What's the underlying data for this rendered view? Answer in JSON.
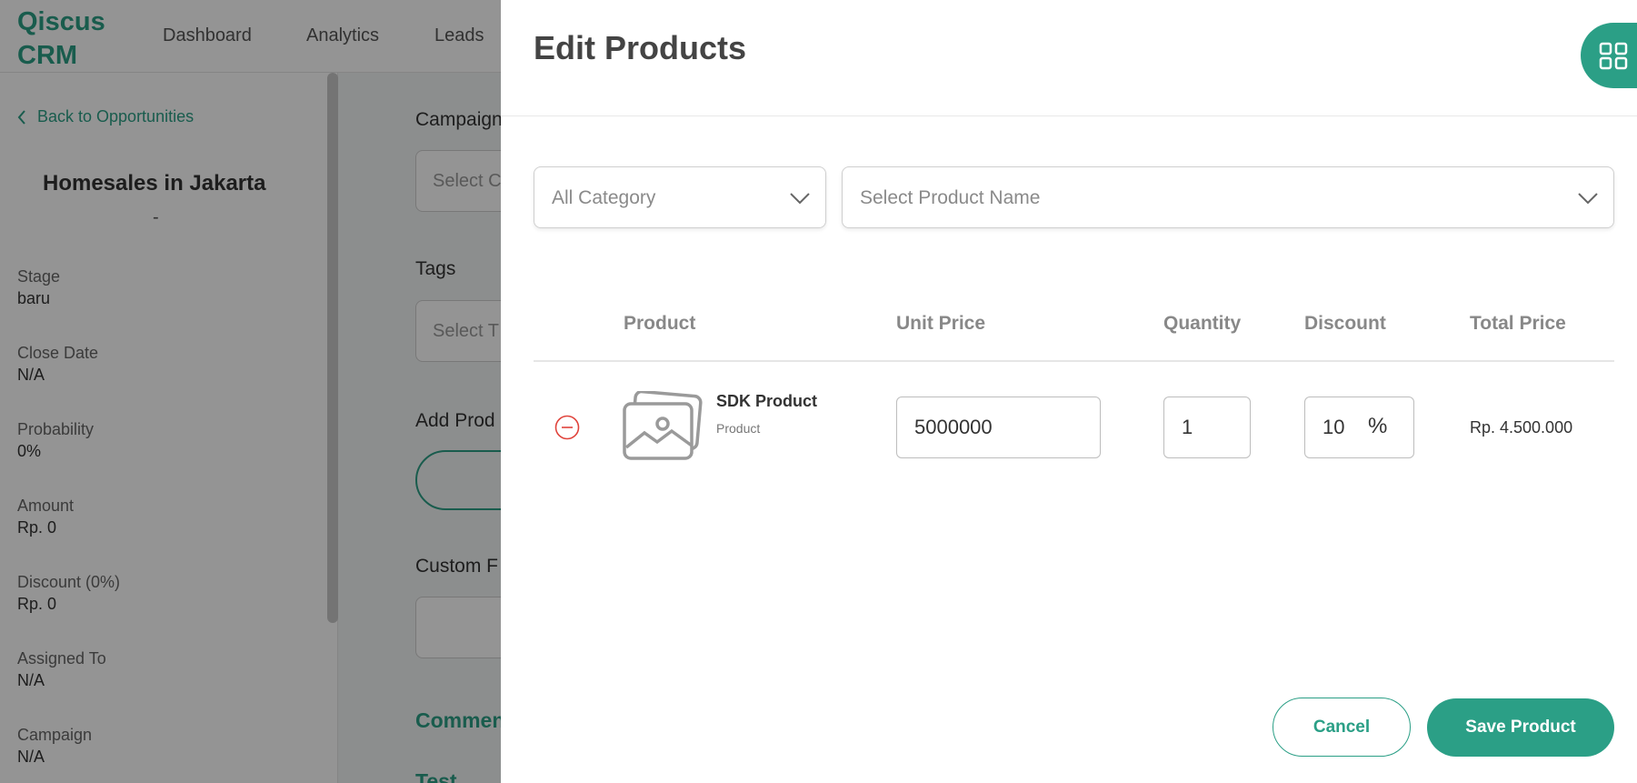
{
  "app": {
    "logo": "Qiscus\nCRM",
    "nav": [
      "Dashboard",
      "Analytics",
      "Leads"
    ]
  },
  "sidebar": {
    "back_label": "Back to Opportunities",
    "title": "Homesales in Jakarta",
    "subtitle": "-",
    "fields": [
      {
        "label": "Stage",
        "value": "baru"
      },
      {
        "label": "Close Date",
        "value": "N/A"
      },
      {
        "label": "Probability",
        "value": "0%"
      },
      {
        "label": "Amount",
        "value": "Rp. 0"
      },
      {
        "label": "Discount (0%)",
        "value": "Rp. 0"
      },
      {
        "label": "Assigned To",
        "value": "N/A"
      },
      {
        "label": "Campaign",
        "value": "N/A"
      }
    ]
  },
  "main": {
    "campaign_label": "Campaign",
    "campaign_placeholder": "Select C",
    "tags_label": "Tags",
    "tags_placeholder": "Select T",
    "add_products_label": "Add Prod",
    "custom_fields_label": "Custom F",
    "comments_label": "Commen",
    "test_label": "Test"
  },
  "drawer": {
    "title": "Edit Products",
    "apps_icon": "grid-apps-icon",
    "category_placeholder": "All Category",
    "product_placeholder": "Select Product Name",
    "table": {
      "headers": [
        "Product",
        "Unit Price",
        "Quantity",
        "Discount",
        "Total Price"
      ],
      "rows": [
        {
          "name": "SDK Product",
          "category": "Product",
          "unit_price": "5000000",
          "quantity": "1",
          "discount": "10",
          "discount_unit": "%",
          "total": "Rp. 4.500.000"
        }
      ]
    },
    "cancel_label": "Cancel",
    "save_label": "Save Product"
  },
  "colors": {
    "brand": "#2b9f86",
    "danger": "#e0443c"
  }
}
